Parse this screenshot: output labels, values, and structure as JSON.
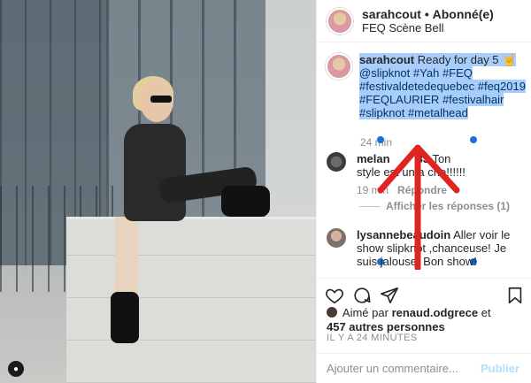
{
  "header": {
    "username": "sarahcout",
    "separator": "•",
    "follow_status": "Abonné(e)",
    "location": "FEQ Scène Bell"
  },
  "caption": {
    "username": "sarahcout",
    "text_start": "Ready for day 5",
    "emoji": "🤘",
    "mention": "@slipknot",
    "hashtags": [
      "#Yah",
      "#FEQ",
      "#festivaldetedequebec",
      "#feq2019",
      "#FEQLAURIER",
      "#festivalhair",
      "#slipknot",
      "#metalhead"
    ],
    "time": "24 min"
  },
  "comments": [
    {
      "username": "melan",
      "username_tail": "83",
      "text_a": "Ton",
      "text_b": "style",
      "text_c": "est",
      "text_d": "un",
      "text_e": "a",
      "text_f": "che!!!!!!",
      "time": "19 min",
      "reply_label": "Répondre",
      "view_replies": "Afficher les réponses (1)"
    },
    {
      "username": "lysannebeaudoin",
      "text": "Aller voir le show slipknot ,chanceuse! Je suis jalouse! Bon show!"
    }
  ],
  "likes": {
    "prefix": "Aimé par",
    "user": "renaud.odgrece",
    "joiner": "et",
    "others": "457 autres personnes"
  },
  "time_ago": "IL Y A 24 MINUTES",
  "comment_box": {
    "placeholder": "Ajouter un commentaire...",
    "publish_label": "Publier"
  },
  "colors": {
    "selection": "#a8cdfa",
    "hashtag": "#003569",
    "publish": "#b2dffc",
    "annotation_arrow": "#e02424"
  }
}
